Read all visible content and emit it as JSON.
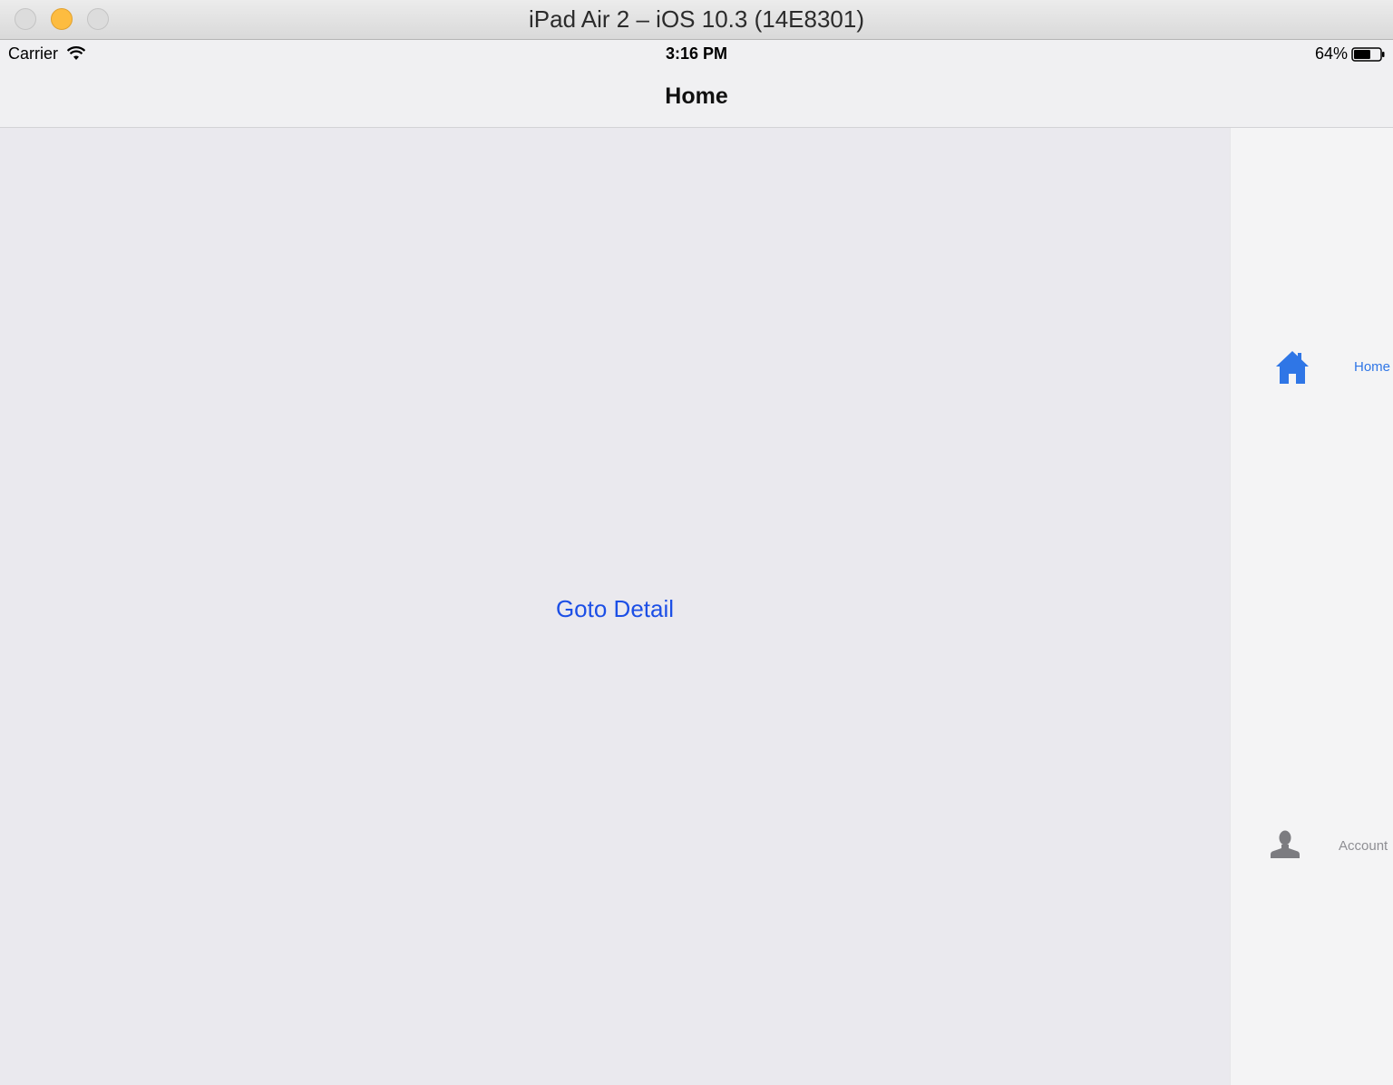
{
  "window": {
    "title": "iPad Air 2 – iOS 10.3 (14E8301)"
  },
  "status_bar": {
    "carrier": "Carrier",
    "time": "3:16 PM",
    "battery_percent": "64%",
    "battery_level": 0.64
  },
  "nav_bar": {
    "title": "Home"
  },
  "content": {
    "goto_detail_label": "Goto Detail"
  },
  "tab_bar": {
    "items": [
      {
        "label": "Home",
        "icon": "house-icon",
        "selected": true
      },
      {
        "label": "Account",
        "icon": "person-icon",
        "selected": false
      }
    ]
  },
  "colors": {
    "accent": "#2f76e6",
    "button_text": "#1c4fe6",
    "unselected_tab": "#8e8e93",
    "content_background": "#eae9ee"
  }
}
